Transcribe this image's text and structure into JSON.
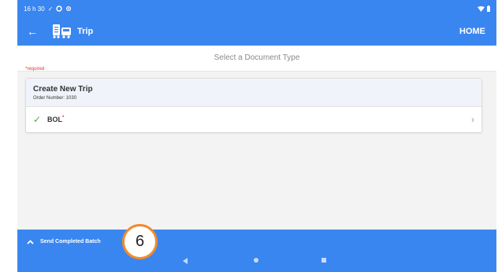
{
  "status_bar": {
    "time": "16 h 30",
    "check_glyph": "✓",
    "icons": [
      "check-icon",
      "c-icon",
      "settings-icon",
      "wifi-icon",
      "battery-icon"
    ]
  },
  "app_bar": {
    "back_glyph": "←",
    "title": "Trip",
    "home_label": "HOME",
    "icon": "truck-icon"
  },
  "subheader": {
    "select_label": "Select a Document Type",
    "required_note": "*required"
  },
  "card": {
    "title": "Create New Trip",
    "order": "Order Number: 1030",
    "document": {
      "label": "BOL",
      "required_mark": "*",
      "check": "✓",
      "chevron": "›"
    }
  },
  "bottom": {
    "batch_label": "Send Completed Batch",
    "up_glyph": "^"
  },
  "callout": {
    "number": "6",
    "color": "#f28a2e"
  },
  "colors": {
    "primary": "#3a86f0",
    "required": "#e0342f",
    "check": "#4caf50"
  }
}
